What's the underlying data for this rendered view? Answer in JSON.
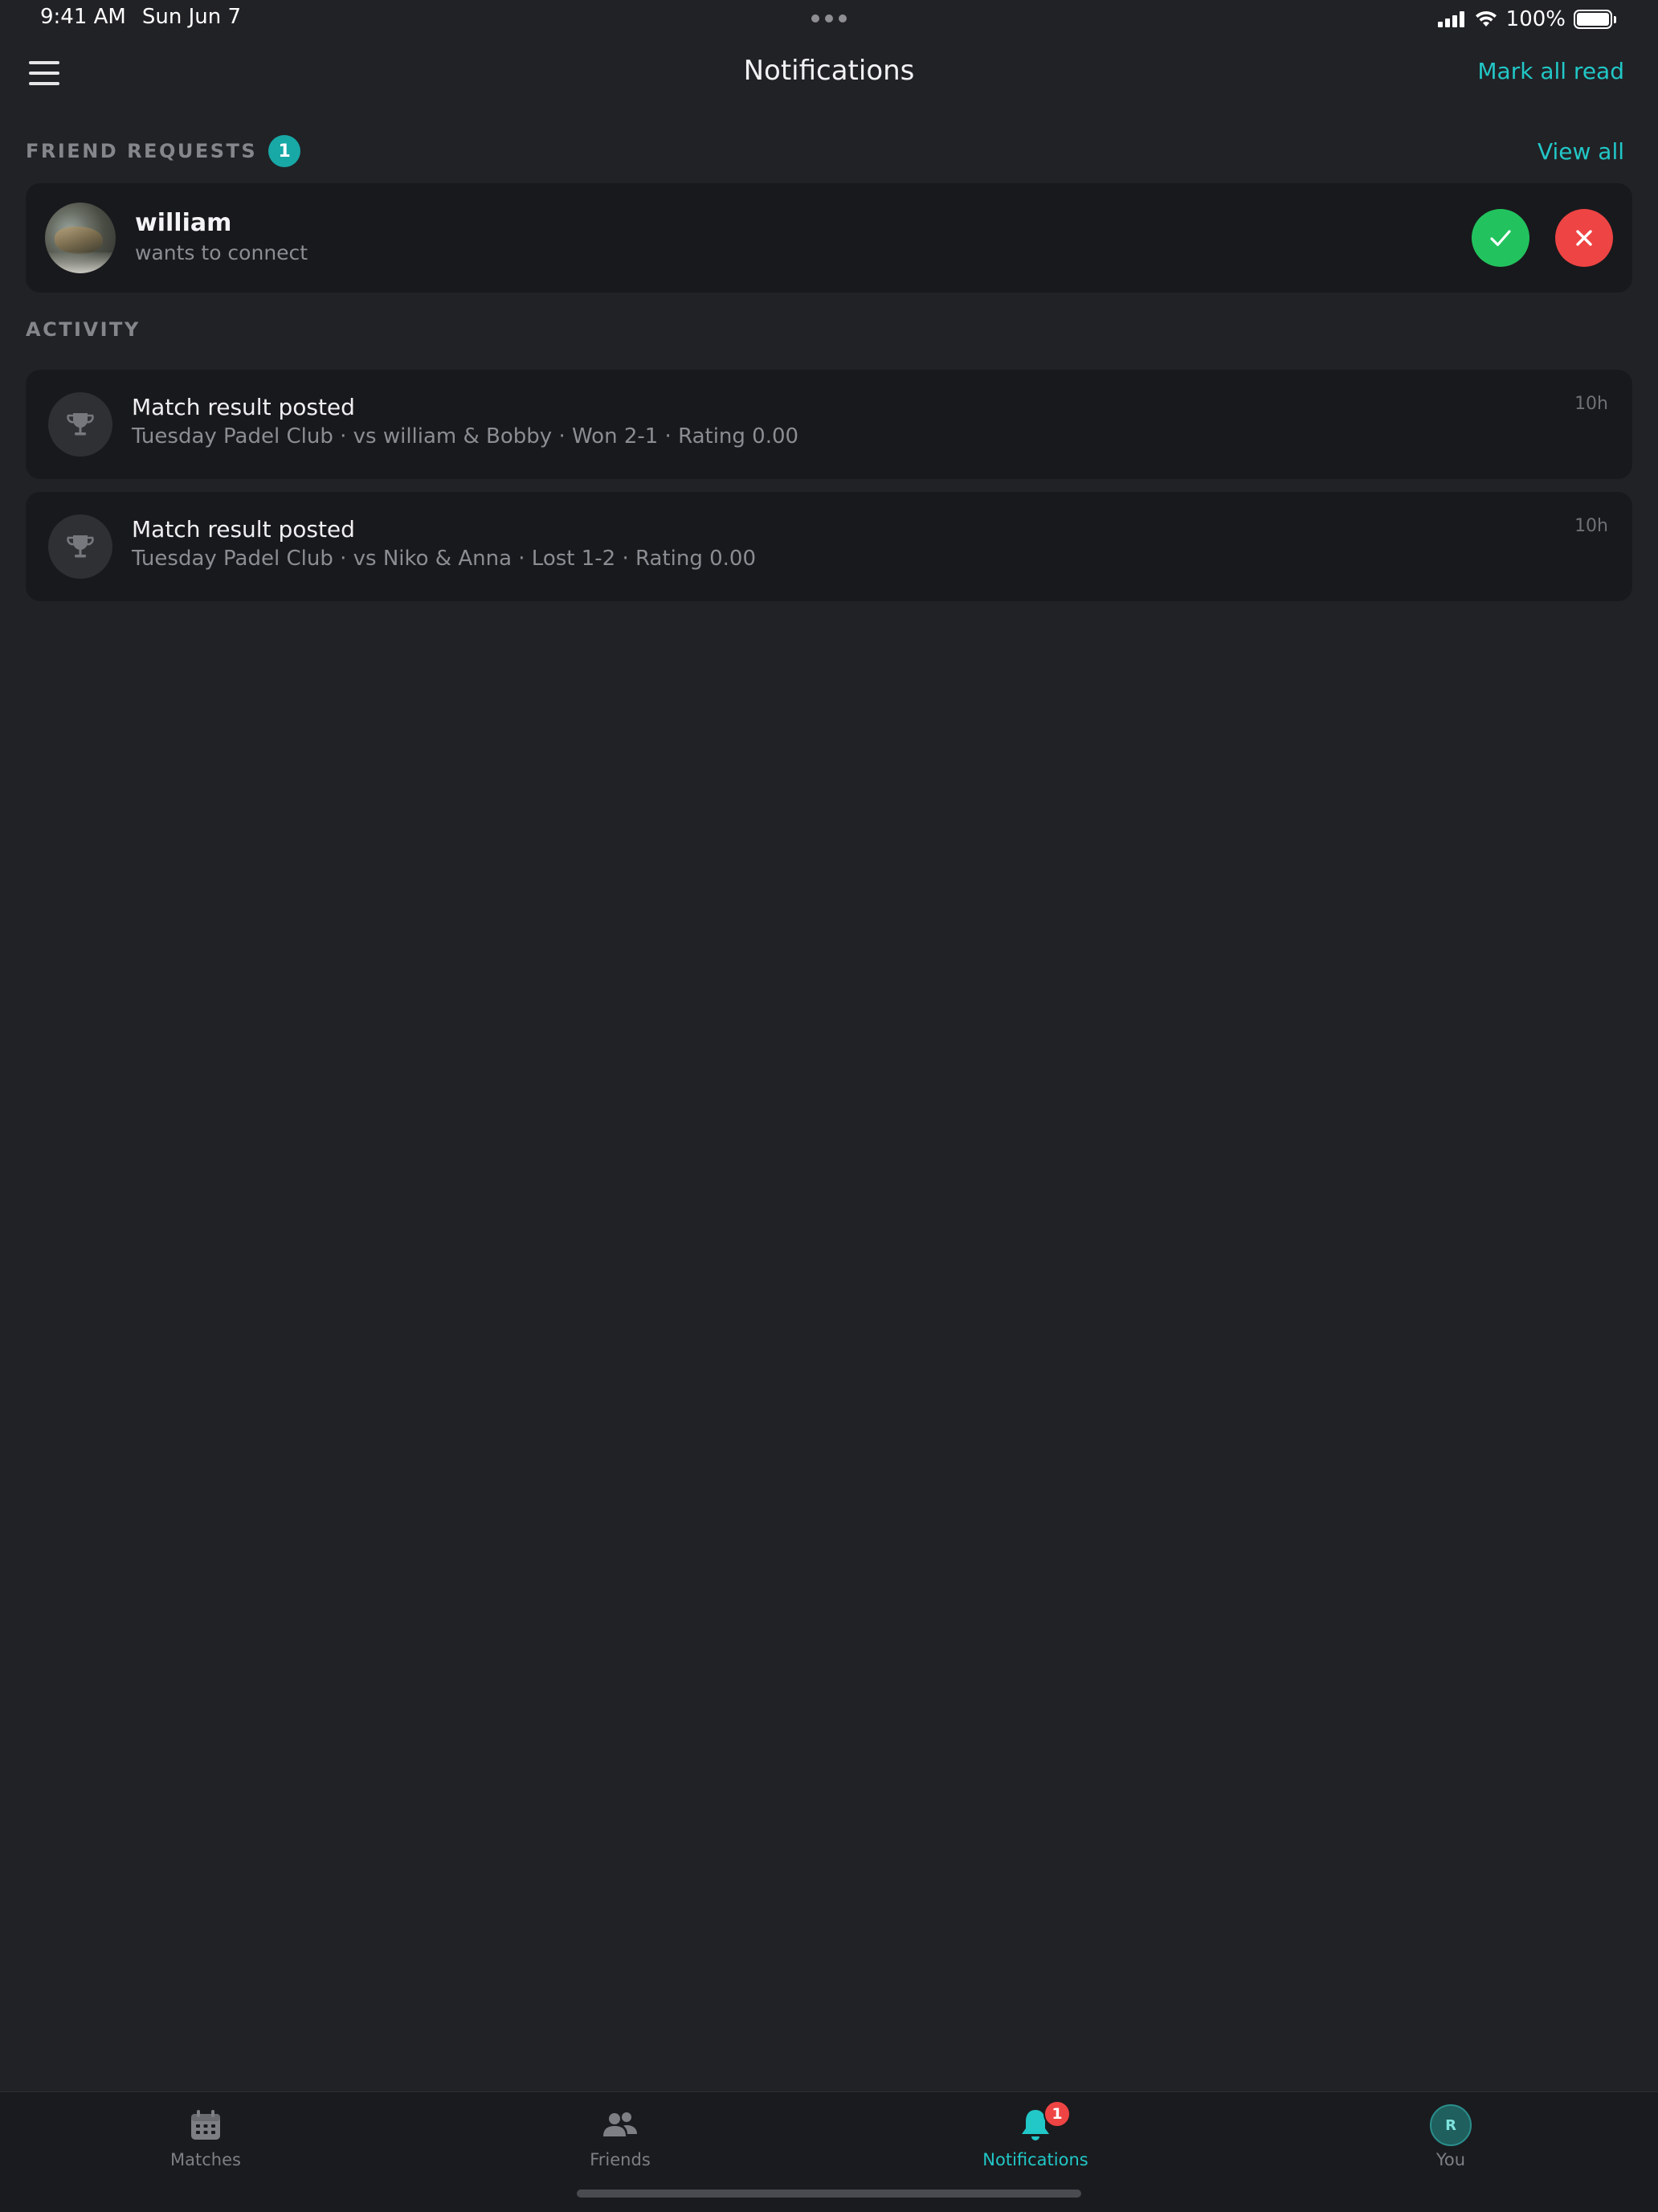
{
  "status_bar": {
    "time": "9:41 AM",
    "date": "Sun Jun 7",
    "battery": "100%"
  },
  "nav": {
    "title": "Notifications",
    "mark_all_read": "Mark all read",
    "menu_icon": "hamburger-menu-icon"
  },
  "friend_requests": {
    "title": "FRIEND REQUESTS",
    "count": "1",
    "view_all": "View all",
    "items": [
      {
        "name": "william",
        "subtitle": "wants to connect"
      }
    ]
  },
  "activity": {
    "title": "ACTIVITY",
    "items": [
      {
        "icon": "trophy-icon",
        "title": "Match result posted",
        "detail": "Tuesday Padel Club · vs william & Bobby · Won 2-1 · Rating 0.00",
        "time": "10h"
      },
      {
        "icon": "trophy-icon",
        "title": "Match result posted",
        "detail": "Tuesday Padel Club · vs Niko & Anna · Lost 1-2 · Rating 0.00",
        "time": "10h"
      }
    ]
  },
  "tab_bar": {
    "tabs": [
      {
        "label": "Matches",
        "icon": "calendar-icon",
        "active": false
      },
      {
        "label": "Friends",
        "icon": "people-icon",
        "active": false
      },
      {
        "label": "Notifications",
        "icon": "bell-icon",
        "active": true,
        "badge": "1"
      },
      {
        "label": "You",
        "icon": "avatar",
        "avatar_initial": "R",
        "active": false
      }
    ]
  },
  "colors": {
    "background": "#212226",
    "card": "#18191C",
    "accent": "#22C7C7",
    "accept": "#22C35E",
    "decline": "#EF4444"
  }
}
